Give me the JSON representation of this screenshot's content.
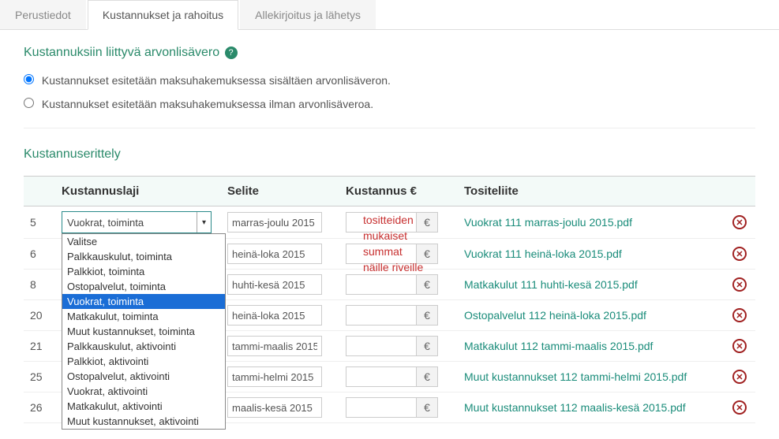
{
  "tabs": {
    "basic": "Perustiedot",
    "costs": "Kustannukset ja rahoitus",
    "sign": "Allekirjoitus ja lähetys"
  },
  "vat_section": {
    "title": "Kustannuksiin liittyvä arvonlisävero",
    "opt_incl": "Kustannukset esitetään maksuhakemuksessa sisältäen arvonlisäveron.",
    "opt_excl": "Kustannukset esitetään maksuhakemuksessa ilman arvonlisäveroa."
  },
  "spec_section": {
    "title": "Kustannuserittely",
    "headers": {
      "type": "Kustannuslaji",
      "desc": "Selite",
      "cost": "Kustannus €",
      "attach": "Tositeliite"
    }
  },
  "annotation": {
    "l1": "tositteiden",
    "l2": "mukaiset",
    "l3": "summat",
    "l4": "näille riveille"
  },
  "select": {
    "current": "Vuokrat, toiminta",
    "options": [
      "Valitse",
      "Palkkauskulut, toiminta",
      "Palkkiot, toiminta",
      "Ostopalvelut, toiminta",
      "Vuokrat, toiminta",
      "Matkakulut, toiminta",
      "Muut kustannukset, toiminta",
      "Palkkauskulut, aktivointi",
      "Palkkiot, aktivointi",
      "Ostopalvelut, aktivointi",
      "Vuokrat, aktivointi",
      "Matkakulut, aktivointi",
      "Muut kustannukset, aktivointi"
    ]
  },
  "rows": [
    {
      "num": "5",
      "desc": "marras-joulu 2015",
      "attach": "Vuokrat 111 marras-joulu 2015.pdf"
    },
    {
      "num": "6",
      "desc": "heinä-loka 2015",
      "attach": "Vuokrat 111 heinä-loka 2015.pdf"
    },
    {
      "num": "8",
      "desc": "huhti-kesä 2015",
      "attach": "Matkakulut 111 huhti-kesä 2015.pdf"
    },
    {
      "num": "20",
      "desc": "heinä-loka 2015",
      "attach": "Ostopalvelut 112 heinä-loka 2015.pdf"
    },
    {
      "num": "21",
      "desc": "tammi-maalis 2015",
      "attach": "Matkakulut 112 tammi-maalis 2015.pdf"
    },
    {
      "num": "25",
      "desc": "tammi-helmi 2015",
      "attach": "Muut kustannukset 112 tammi-helmi 2015.pdf"
    },
    {
      "num": "26",
      "desc": "maalis-kesä 2015",
      "attach": "Muut kustannukset 112 maalis-kesä 2015.pdf"
    }
  ],
  "euro": "€",
  "cross": "✕",
  "help": "?"
}
